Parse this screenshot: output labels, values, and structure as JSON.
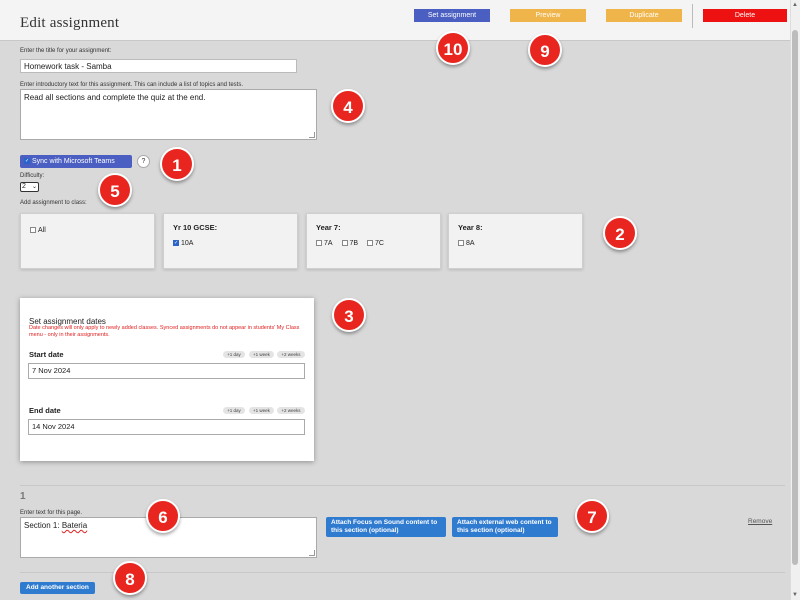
{
  "header": {
    "title": "Edit assignment",
    "set_assignment_label": "Set assignment",
    "preview_label": "Preview",
    "duplicate_label": "Duplicate",
    "delete_label": "Delete"
  },
  "title_field": {
    "label": "Enter the title for your assignment:",
    "value": "Homework task - Samba"
  },
  "intro_field": {
    "label": "Enter introductory text for this assignment. This can include a list of topics and tests.",
    "value": "Read all sections and complete the quiz at the end."
  },
  "sync": {
    "label": "Sync with Microsoft Teams",
    "checked": true,
    "help": "?"
  },
  "difficulty": {
    "label": "Difficulty:",
    "value": "2"
  },
  "classes": {
    "label": "Add assignment to class:",
    "cards": [
      {
        "title": "",
        "options": [
          {
            "label": "All",
            "checked": false
          }
        ]
      },
      {
        "title": "Yr 10 GCSE:",
        "options": [
          {
            "label": "10A",
            "checked": true
          }
        ]
      },
      {
        "title": "Year 7:",
        "options": [
          {
            "label": "7A",
            "checked": false
          },
          {
            "label": "7B",
            "checked": false
          },
          {
            "label": "7C",
            "checked": false
          }
        ]
      },
      {
        "title": "Year 8:",
        "options": [
          {
            "label": "8A",
            "checked": false
          }
        ]
      }
    ]
  },
  "dates": {
    "title": "Set assignment dates",
    "warning": "Date changes will only apply to newly added classes. Synced assignments do not appear in students' My Class menu - only in their assignments.",
    "start_label": "Start date",
    "start_value": "7 Nov 2024",
    "end_label": "End date",
    "end_value": "14 Nov 2024",
    "chips": [
      "+1 day",
      "+1 week",
      "+2 weeks"
    ]
  },
  "section": {
    "number": "1",
    "text_label": "Enter text for this page.",
    "text_prefix": "Section 1: ",
    "text_misspelled": "Bateria",
    "attach_focus_label": "Attach Focus on Sound content to this section (optional)",
    "attach_web_label": "Attach external web content to this section (optional)",
    "remove_label": "Remove"
  },
  "add_section_label": "Add another section",
  "badges": [
    "1",
    "2",
    "3",
    "4",
    "5",
    "6",
    "7",
    "8",
    "9",
    "10"
  ],
  "colors": {
    "primary_blue": "#4a5fc1",
    "preview_orange": "#f0b54a",
    "delete_red": "#ee1111",
    "action_blue": "#2f7bd0",
    "badge_red": "#e8261f",
    "warning_red": "#e02020"
  }
}
